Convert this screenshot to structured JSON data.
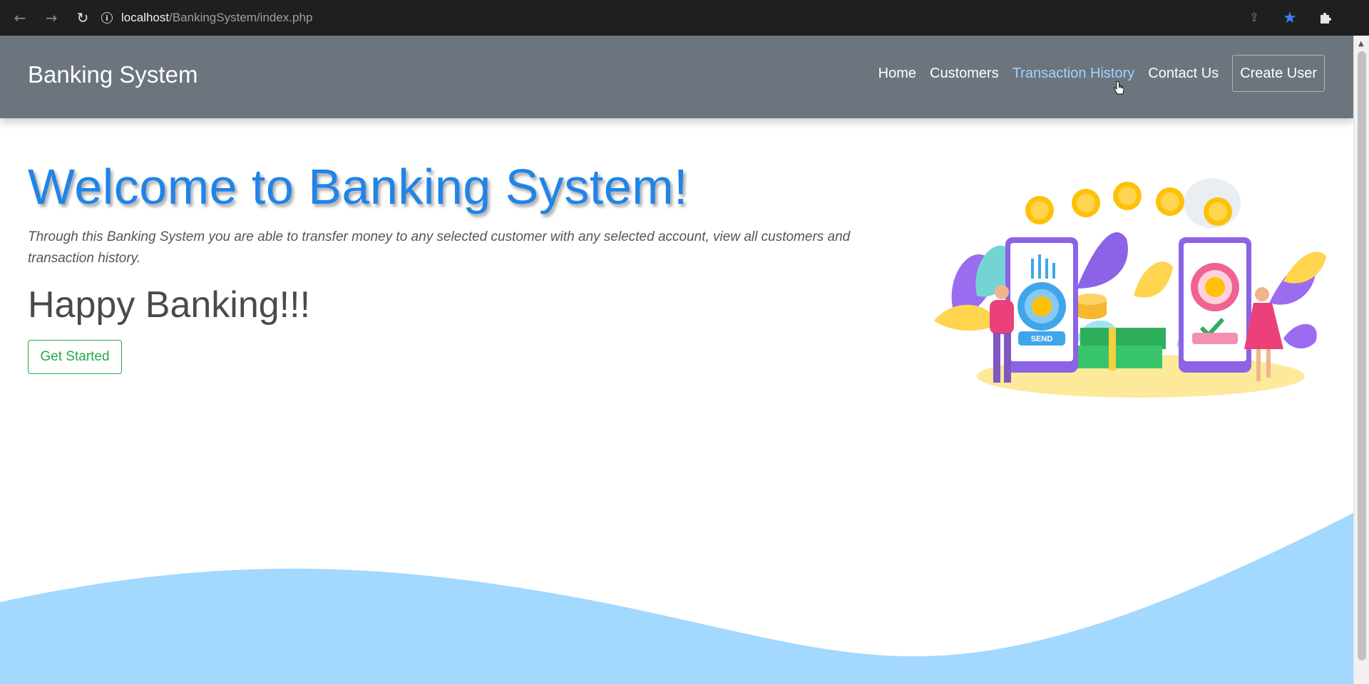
{
  "browser": {
    "url_host": "localhost",
    "url_path": "/BankingSystem/index.php"
  },
  "navbar": {
    "brand": "Banking System",
    "links": [
      {
        "label": "Home"
      },
      {
        "label": "Customers"
      },
      {
        "label": "Transaction History",
        "active": true
      },
      {
        "label": "Contact Us"
      }
    ],
    "create_user": "Create User"
  },
  "hero": {
    "title": "Welcome to Banking System!",
    "description": "Through this Banking System you are able to transfer money to any selected customer with any selected account, view all customers and transaction history.",
    "subtitle": "Happy Banking!!!",
    "cta": "Get Started",
    "illustration_send_label": "SEND"
  },
  "colors": {
    "navbar_bg": "#6c757d",
    "title_blue": "#1f84e8",
    "cta_green": "#28a745",
    "wave_blue": "#a3d8ff",
    "active_link": "#9fd3ff"
  },
  "icons": {
    "back": "arrow-left",
    "forward": "arrow-right",
    "reload": "reload",
    "site_info": "info",
    "share": "share",
    "bookmark": "star",
    "extensions": "puzzle",
    "profile": "avatar"
  }
}
